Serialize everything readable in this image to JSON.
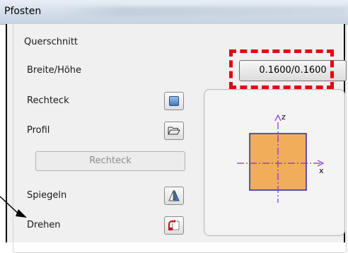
{
  "window": {
    "title": "Pfosten"
  },
  "group": {
    "label": "Querschnitt"
  },
  "rows": {
    "breite_hoehe": "Breite/Höhe",
    "rechteck": "Rechteck",
    "profil": "Profil",
    "spiegeln": "Spiegeln",
    "drehen": "Drehen"
  },
  "buttons": {
    "dimension_value": "0.1600/0.1600",
    "rechteck_disabled": "Rechteck"
  },
  "preview": {
    "axis_z": "z",
    "axis_x": "x",
    "fill_color": "#f0ad5a",
    "outline_color": "#2a2aa8",
    "axis_color": "#8a2be2"
  },
  "annotation": {
    "highlight_color": "#e30613"
  },
  "icons": {
    "rechteck": "square-icon",
    "profil": "folder-open-icon",
    "spiegeln": "mirror-icon",
    "drehen": "rotate-icon"
  }
}
